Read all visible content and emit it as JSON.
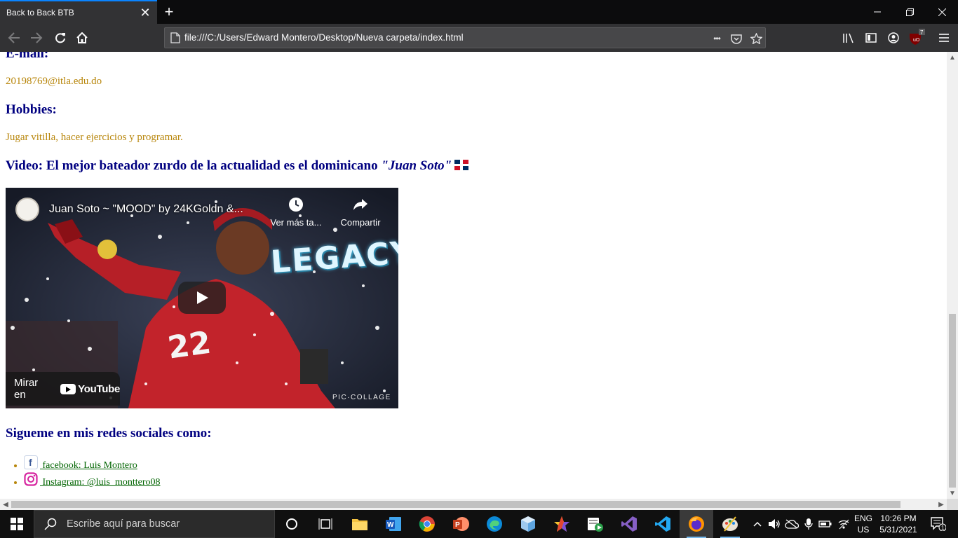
{
  "browser": {
    "tab_title": "Back to Back BTB",
    "tab_close": "✕",
    "new_tab": "+",
    "url": "file:///C:/Users/Edward Montero/Desktop/Nueva carpeta/index.html",
    "more": "•••",
    "notification_count": "7"
  },
  "page": {
    "email_heading": "E-mail:",
    "email_value": "20198769@itla.edu.do",
    "hobbies_heading": "Hobbies:",
    "hobbies_value": "Jugar vitilla, hacer ejercicios y programar.",
    "video_heading_prefix": "Video: El mejor bateador zurdo de la actualidad es el dominicano ",
    "video_heading_name": "\"Juan Soto\"",
    "social_heading": "Sigueme en mis redes sociales como:",
    "social_links": [
      {
        "label": " facebook: Luis Montero",
        "icon": "facebook-icon"
      },
      {
        "label": " Instagram: @luis_monttero08",
        "icon": "instagram-icon"
      }
    ]
  },
  "video": {
    "title": "Juan Soto ~ \"MOOD\" by 24KGoldn &...",
    "watch_later": "Ver más ta...",
    "share": "Compartir",
    "watch_on": "Mirar en",
    "youtube": "YouTube",
    "overlay_text": "LEGACY",
    "jersey_number": "22",
    "watermark": "PIC·COLLAGE"
  },
  "taskbar": {
    "search_placeholder": "Escribe aquí para buscar",
    "language_top": "ENG",
    "language_bottom": "US",
    "time": "10:26 PM",
    "date": "5/31/2021",
    "notification_badge": "1"
  },
  "colors": {
    "heading": "#000080",
    "text": "#b8860b",
    "link": "#006400",
    "tab_accent": "#0a84ff"
  }
}
